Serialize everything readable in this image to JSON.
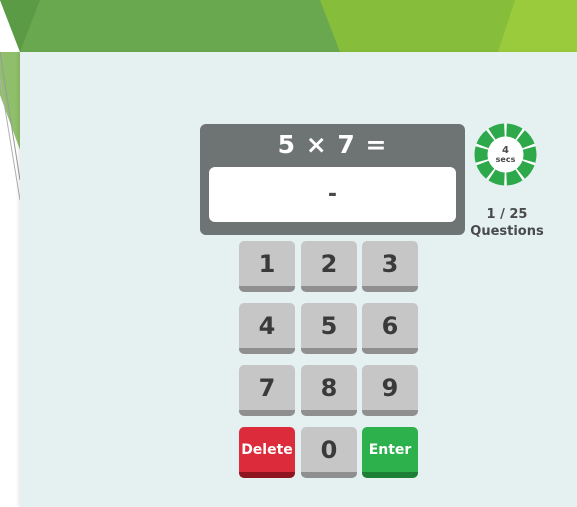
{
  "theme": {
    "panel_bg": "#e5f1f1",
    "header_green_dark": "#6aa84f",
    "header_green_light": "#92c83e",
    "display_bg": "#6e7474",
    "key_gray": "#c6c6c6",
    "delete_red": "#dc2b3a",
    "enter_green": "#2db14c",
    "timer_green": "#2da84a"
  },
  "question": {
    "text": "5 × 7 =",
    "answer_display": "-"
  },
  "timer": {
    "value": "4",
    "unit": "secs",
    "remaining_fraction": 1.0,
    "icon": "countdown-ring-icon"
  },
  "progress": {
    "count": "1 / 25",
    "label": "Questions"
  },
  "keypad": {
    "key_1": "1",
    "key_2": "2",
    "key_3": "3",
    "key_4": "4",
    "key_5": "5",
    "key_6": "6",
    "key_7": "7",
    "key_8": "8",
    "key_9": "9",
    "delete_label": "Delete",
    "key_0": "0",
    "enter_label": "Enter"
  }
}
